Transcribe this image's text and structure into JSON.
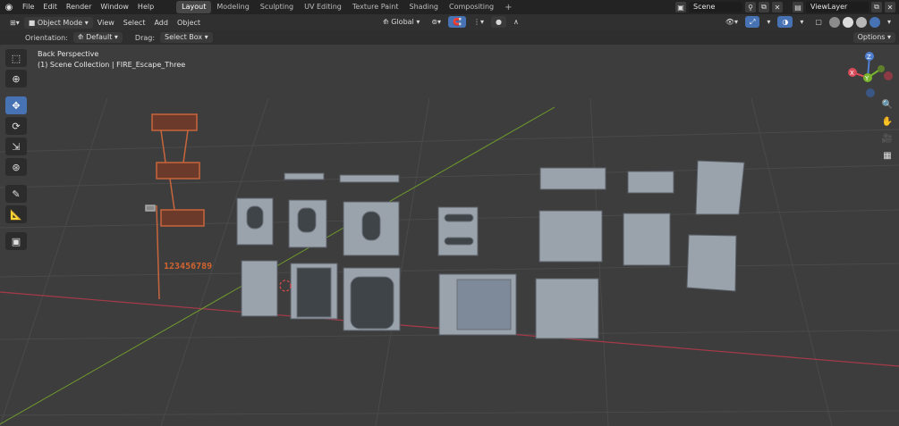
{
  "topbar": {
    "menus": [
      "File",
      "Edit",
      "Render",
      "Window",
      "Help"
    ],
    "workspaces": [
      "Layout",
      "Modeling",
      "Sculpting",
      "UV Editing",
      "Texture Paint",
      "Shading",
      "Compositing"
    ],
    "active_workspace": "Layout",
    "add_workspace": "+",
    "scene_name": "Scene",
    "view_layer": "ViewLayer"
  },
  "header": {
    "mode": "Object Mode",
    "menus": [
      "View",
      "Select",
      "Add",
      "Object"
    ],
    "transform_orientation": "Global"
  },
  "toolsettings": {
    "orientation_label": "Orientation:",
    "orientation_value": "Default",
    "drag_label": "Drag:",
    "drag_value": "Select Box",
    "options_label": "Options"
  },
  "viewport": {
    "view_name": "Back Perspective",
    "collection_info": "(1) Scene Collection | FIRE_Escape_Three",
    "number_sign_text": "123456789"
  },
  "gizmo": {
    "z_label": "Z",
    "x_label": "X",
    "y_label": "Y"
  },
  "colors": {
    "accent": "#4772b3",
    "grid_x_axis": "#a83a4a",
    "grid_y_axis": "#6e9a2c",
    "viewport_bg": "#3d3d3d",
    "object_gray": "#9aa2ab",
    "fire_escape_orange": "#c8653c"
  },
  "icons": {
    "toolbar": [
      "select-box-icon",
      "cursor-icon",
      "move-icon",
      "rotate-icon",
      "scale-icon",
      "transform-icon",
      "annotate-icon",
      "measure-icon",
      "add-cube-icon"
    ],
    "nav": [
      "zoom-icon",
      "hand-pan-icon",
      "camera-icon",
      "grid-icon"
    ]
  }
}
